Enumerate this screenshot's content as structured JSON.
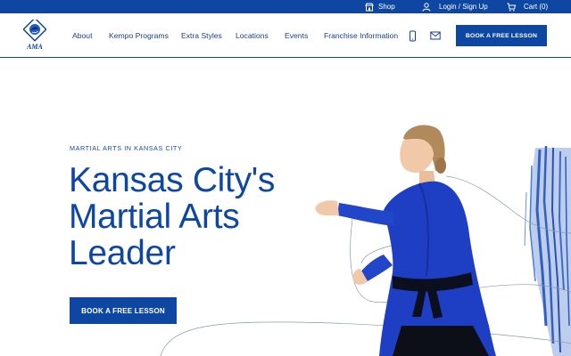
{
  "topbar": {
    "shop": "Shop",
    "login": "Login / Sign Up",
    "cart": "Cart (0)"
  },
  "header": {
    "logo_text": "AMA",
    "nav": [
      "About",
      "Kempo Programs",
      "Extra Styles",
      "Locations",
      "Events",
      "Franchise Information"
    ],
    "cta": "BOOK A FREE LESSON"
  },
  "hero": {
    "eyebrow": "MARTIAL ARTS IN KANSAS CITY",
    "headline_lines": [
      "Kansas City's",
      "Martial Arts",
      "Leader"
    ],
    "cta": "BOOK A FREE LESSON"
  },
  "colors": {
    "brand_blue": "#0d47a1",
    "text_blue": "#1a3e8c",
    "white": "#ffffff"
  },
  "icons": [
    "store-icon",
    "user-icon",
    "cart-icon",
    "phone-icon",
    "mail-icon"
  ]
}
